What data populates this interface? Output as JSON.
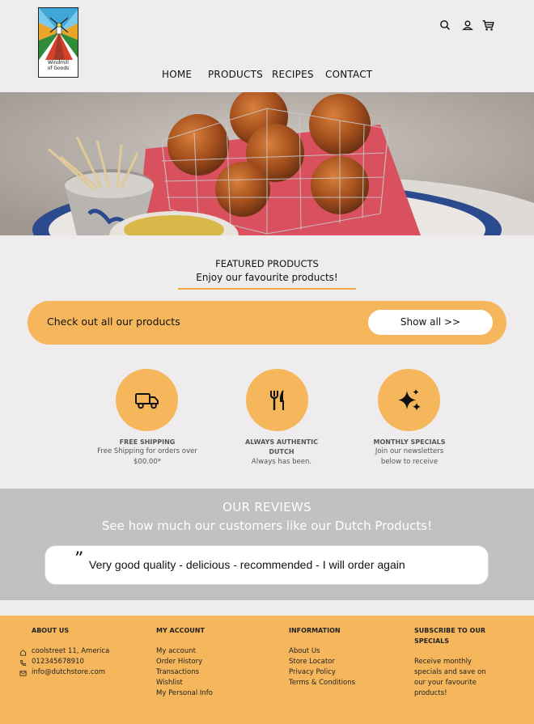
{
  "brand": {
    "logo_line1": "Windmill",
    "logo_line2": "of Goods"
  },
  "nav": {
    "home": "HOME",
    "products": "PRODUCTS",
    "recipes": "RECIPES",
    "contact": "CONTACT"
  },
  "header_icons": [
    "search-icon",
    "user-icon",
    "cart-icon"
  ],
  "featured": {
    "title": "FEATURED PRODUCTS",
    "subtitle": "Enjoy our favourite products!",
    "banner_text": "Check out all our products",
    "banner_button": "Show all >>"
  },
  "features": [
    {
      "icon": "truck-icon",
      "title": "FREE SHIPPING",
      "desc_line1": "Free Shipping for orders over",
      "desc_line2": "$00.00*"
    },
    {
      "icon": "fork-knife-icon",
      "title_line1": "ALWAYS AUTHENTIC",
      "title_line2": "DUTCH",
      "desc_line1": "Always has been."
    },
    {
      "icon": "sparkle-icon",
      "title": "MONTHLY SPECIALS",
      "desc_line1": "Join our newsletters",
      "desc_line2": "below to receive"
    }
  ],
  "reviews": {
    "title": "OUR REVIEWS",
    "subtitle": "See how much our customers like our Dutch Products!",
    "quote_mark": "”",
    "text": "Very good quality - delicious - recommended - I will order again"
  },
  "footer": {
    "about": {
      "heading": "ABOUT US",
      "address": "coolstreet 11, America",
      "phone": "012345678910",
      "email": "info@dutchstore.com"
    },
    "account": {
      "heading": "MY ACCOUNT",
      "items": [
        "My account",
        "Order History",
        "Transactions",
        "Wishlist",
        "My Personal Info"
      ]
    },
    "information": {
      "heading": "INFORMATION",
      "items": [
        "About Us",
        "Store Locator",
        "Privacy Policy",
        "Terms & Conditions"
      ]
    },
    "subscribe": {
      "heading_line1": "SUBSCRIBE TO OUR",
      "heading_line2": "SPECIALS",
      "text_lines": [
        "Receive monthly",
        "specials and save on",
        "our your favourite",
        "products!"
      ]
    }
  },
  "colors": {
    "accent": "#f6b75c",
    "background": "#eeecec",
    "reviews_bg": "#c1c1c1",
    "underline": "#f0a640"
  }
}
